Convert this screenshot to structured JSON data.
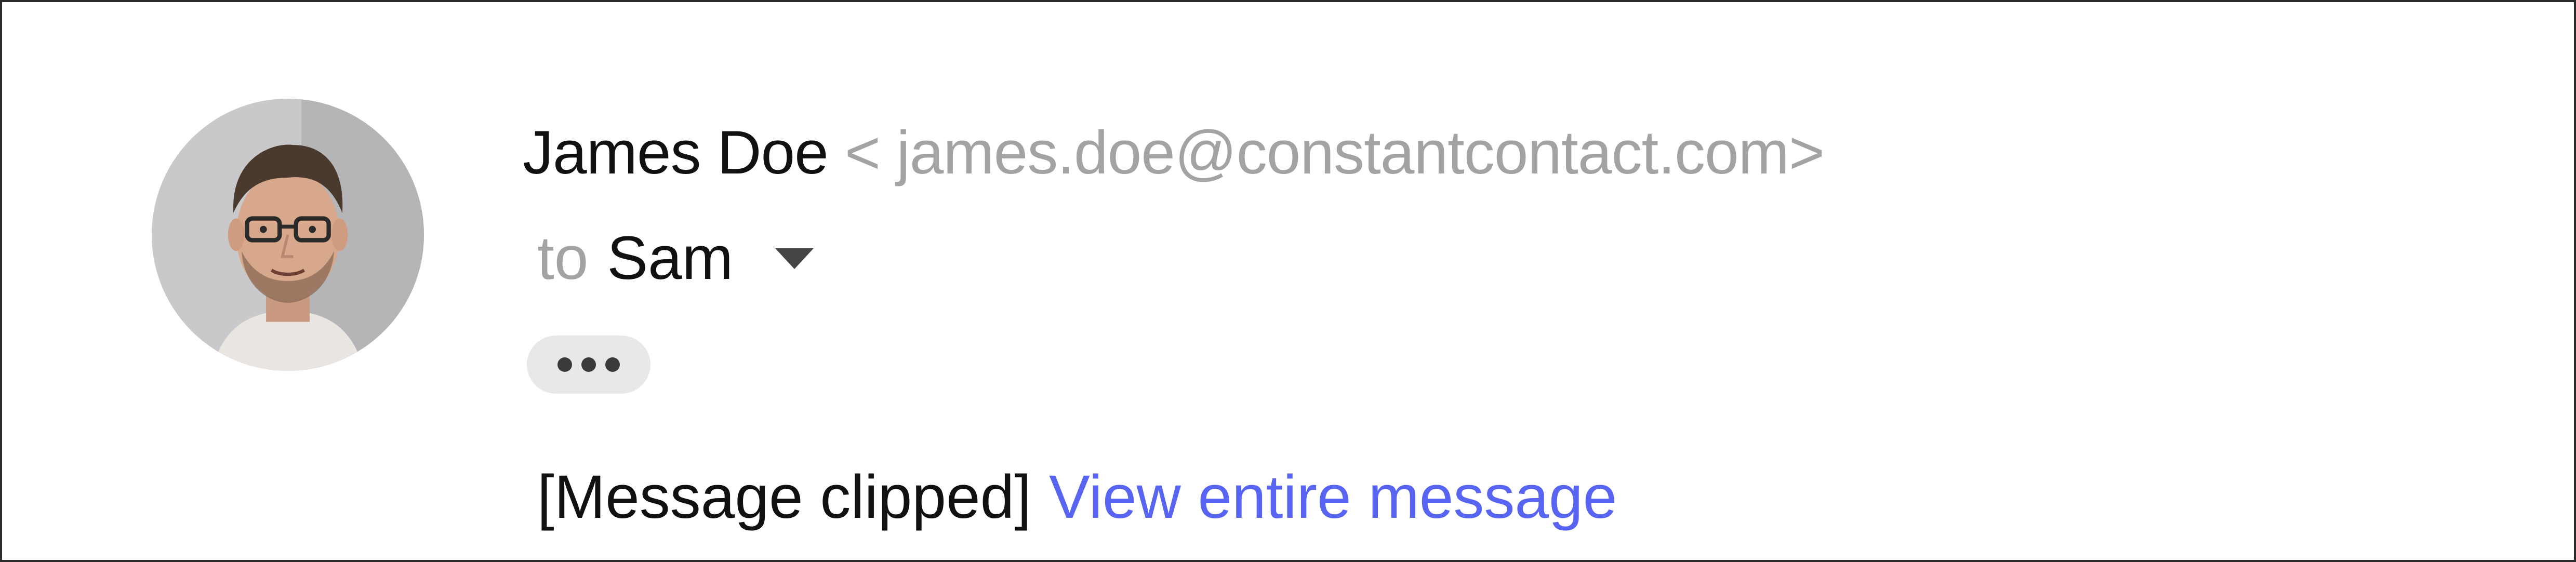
{
  "sender": {
    "name": "James Doe",
    "email_display": "< james.doe@constantcontact.com>"
  },
  "recipient": {
    "prefix": "to",
    "name": "Sam"
  },
  "icons": {
    "avatar": "sender-avatar-photo",
    "dropdown": "caret-down-icon",
    "more": "ellipsis-icon"
  },
  "message": {
    "clipped_notice": "[Message clipped]",
    "view_link": "View entire message"
  },
  "colors": {
    "link": "#5865f2",
    "muted_text": "#a3a3a3",
    "primary_text": "#111111",
    "pill_background": "#e8e8ea"
  }
}
